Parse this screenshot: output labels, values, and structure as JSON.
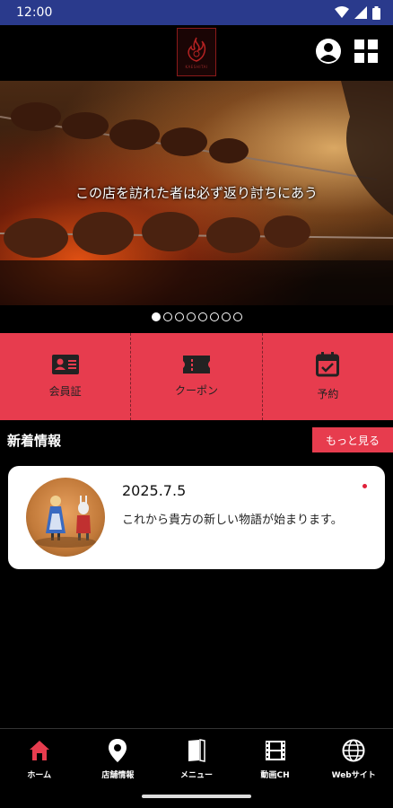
{
  "status_bar": {
    "time": "12:00"
  },
  "header": {
    "logo_text": "KAESHITAI",
    "profile_icon": "account-circle-icon",
    "menu_icon": "grid-menu-icon"
  },
  "hero": {
    "caption": "この店を訪れた者は必ず返り討ちにあう",
    "slide_count": 8,
    "active_slide": 1
  },
  "quick_menu": {
    "items": [
      {
        "label": "会員証",
        "icon": "member-card-icon"
      },
      {
        "label": "クーポン",
        "icon": "coupon-icon"
      },
      {
        "label": "予約",
        "icon": "calendar-check-icon"
      }
    ]
  },
  "news": {
    "title": "新着情報",
    "more_label": "もっと見る",
    "items": [
      {
        "date": "2025.7.5",
        "text": "これから貴方の新しい物語が始まります。"
      }
    ]
  },
  "tab_bar": {
    "tabs": [
      {
        "label": "ホーム",
        "icon": "home-icon"
      },
      {
        "label": "店舗情報",
        "icon": "map-pin-icon"
      },
      {
        "label": "メニュー",
        "icon": "book-icon"
      },
      {
        "label": "動画CH",
        "icon": "film-icon"
      },
      {
        "label": "Webサイト",
        "icon": "globe-icon"
      }
    ],
    "active_index": 0
  },
  "colors": {
    "status_bar": "#2a3a8c",
    "accent": "#e73c4e",
    "active_tab": "#e73c4e",
    "background": "#000000"
  }
}
